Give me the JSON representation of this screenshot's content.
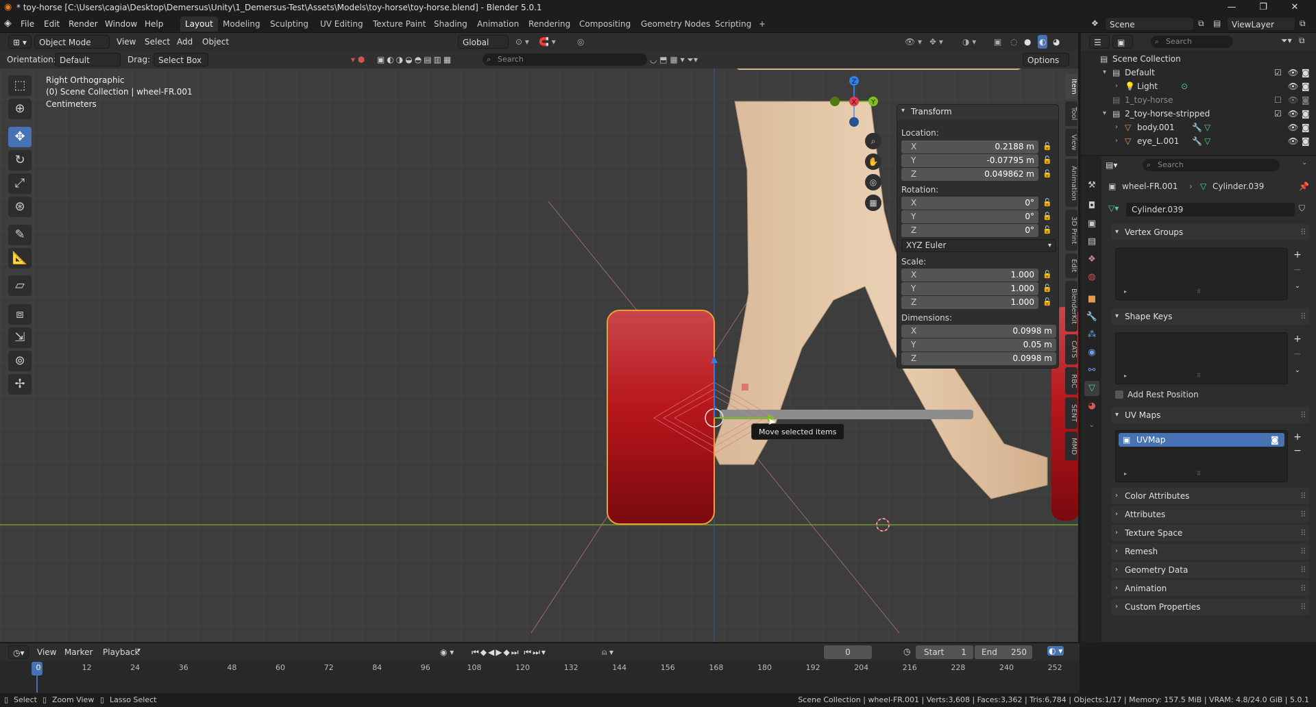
{
  "window": {
    "title": "* toy-horse [C:\\Users\\cagia\\Desktop\\Demersus\\Unity\\1_Demersus-Test\\Assets\\Models\\toy-horse\\toy-horse.blend] - Blender 5.0.1"
  },
  "menu": [
    "File",
    "Edit",
    "Render",
    "Window",
    "Help"
  ],
  "workspaces": [
    "Layout",
    "Modeling",
    "Sculpting",
    "UV Editing",
    "Texture Paint",
    "Shading",
    "Animation",
    "Rendering",
    "Compositing",
    "Geometry Nodes",
    "Scripting"
  ],
  "topright": {
    "scene": "Scene",
    "viewlayer": "ViewLayer"
  },
  "viewport_header": {
    "mode": "Object Mode",
    "view": "View",
    "select": "Select",
    "add": "Add",
    "object": "Object",
    "orientation": "Global",
    "options": "Options",
    "search_placeholder": "Search"
  },
  "tool_header": {
    "orientation_label": "Orientation:",
    "orientation_value": "Default",
    "drag_label": "Drag:",
    "drag_value": "Select Box"
  },
  "viewport_overlay": {
    "view_name": "Right Orthographic",
    "collection": "(0) Scene Collection | wheel-FR.001",
    "units": "Centimeters"
  },
  "tooltip": "Move selected items",
  "transform": {
    "title": "Transform",
    "location_label": "Location:",
    "location": {
      "x": "0.2188 m",
      "y": "-0.07795 m",
      "z": "0.049862 m"
    },
    "rotation_label": "Rotation:",
    "rotation": {
      "x": "0°",
      "y": "0°",
      "z": "0°"
    },
    "rotation_mode": "XYZ Euler",
    "scale_label": "Scale:",
    "scale": {
      "x": "1.000",
      "y": "1.000",
      "z": "1.000"
    },
    "dimensions_label": "Dimensions:",
    "dimensions": {
      "x": "0.0998 m",
      "y": "0.05 m",
      "z": "0.0998 m"
    },
    "axes": {
      "x": "X",
      "y": "Y",
      "z": "Z"
    }
  },
  "npanel_tabs": [
    "Item",
    "Tool",
    "View",
    "Animation",
    "3D Print",
    "Edit",
    "BlenderKit",
    "CATS",
    "RBC",
    "SENT",
    "MMD"
  ],
  "outliner": {
    "search_placeholder": "Search",
    "rows": [
      "Scene Collection",
      "Default",
      "Light",
      "1_toy-horse",
      "2_toy-horse-stripped",
      "body.001",
      "eye_L.001"
    ]
  },
  "properties": {
    "search_placeholder": "Search",
    "breadcrumb_object": "wheel-FR.001",
    "breadcrumb_mesh": "Cylinder.039",
    "mesh_name": "Cylinder.039",
    "panels": {
      "vertex_groups": "Vertex Groups",
      "shape_keys": "Shape Keys",
      "add_rest_position": "Add Rest Position",
      "uv_maps": "UV Maps",
      "uvmap_item": "UVMap",
      "color_attributes": "Color Attributes",
      "attributes": "Attributes",
      "texture_space": "Texture Space",
      "remesh": "Remesh",
      "geometry_data": "Geometry Data",
      "animation": "Animation",
      "custom_properties": "Custom Properties"
    }
  },
  "timeline": {
    "view": "View",
    "marker": "Marker",
    "playback": "Playback",
    "current_frame": "0",
    "start_label": "Start",
    "start": "1",
    "end_label": "End",
    "end": "250",
    "ticks": [
      "0",
      "12",
      "24",
      "36",
      "48",
      "60",
      "72",
      "84",
      "96",
      "108",
      "120",
      "132",
      "144",
      "156",
      "168",
      "180",
      "192",
      "204",
      "216",
      "228",
      "240",
      "252"
    ]
  },
  "status": {
    "select": "Select",
    "zoom": "Zoom View",
    "lasso": "Lasso Select",
    "info": "Scene Collection | wheel-FR.001 | Verts:3,608 | Faces:3,362 | Tris:6,784 | Objects:1/17 | Memory: 157.5 MiB | VRAM: 4.8/24.0 GiB | 5.0.1"
  },
  "colors": {
    "accent": "#4772b3",
    "wheel": "#b01a1f",
    "selection_outline": "#f0a030",
    "axis_x": "#e8384e",
    "axis_y": "#7fbf1c",
    "axis_z": "#2f7fe8"
  }
}
